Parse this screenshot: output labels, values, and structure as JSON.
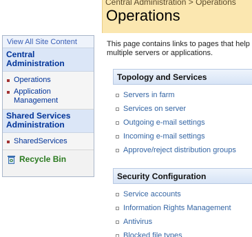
{
  "nav": {
    "view_all": "View All Site Content",
    "sections": [
      {
        "title": "Central Administration",
        "items": [
          "Operations",
          "Application Management"
        ]
      },
      {
        "title": "Shared Services Administration",
        "items": [
          "SharedServices"
        ]
      }
    ],
    "recycle_bin": "Recycle Bin"
  },
  "header": {
    "breadcrumb": "Central Administration > Operations",
    "title": "Operations"
  },
  "description": [
    "This page contains links to pages that help y",
    "multiple servers or applications."
  ],
  "sections": [
    {
      "title": "Topology and Services",
      "links": [
        "Servers in farm",
        "Services on server",
        "Outgoing e-mail settings",
        "Incoming e-mail settings",
        "Approve/reject distribution groups"
      ]
    },
    {
      "title": "Security Configuration",
      "links": [
        "Service accounts",
        "Information Rights Management",
        "Antivirus",
        "Blocked file types"
      ]
    }
  ],
  "colors": {
    "nav_link": "#003399",
    "content_link": "#3465a4",
    "title_bg": "#fbe7b0",
    "recycle": "#2a7a1f"
  }
}
